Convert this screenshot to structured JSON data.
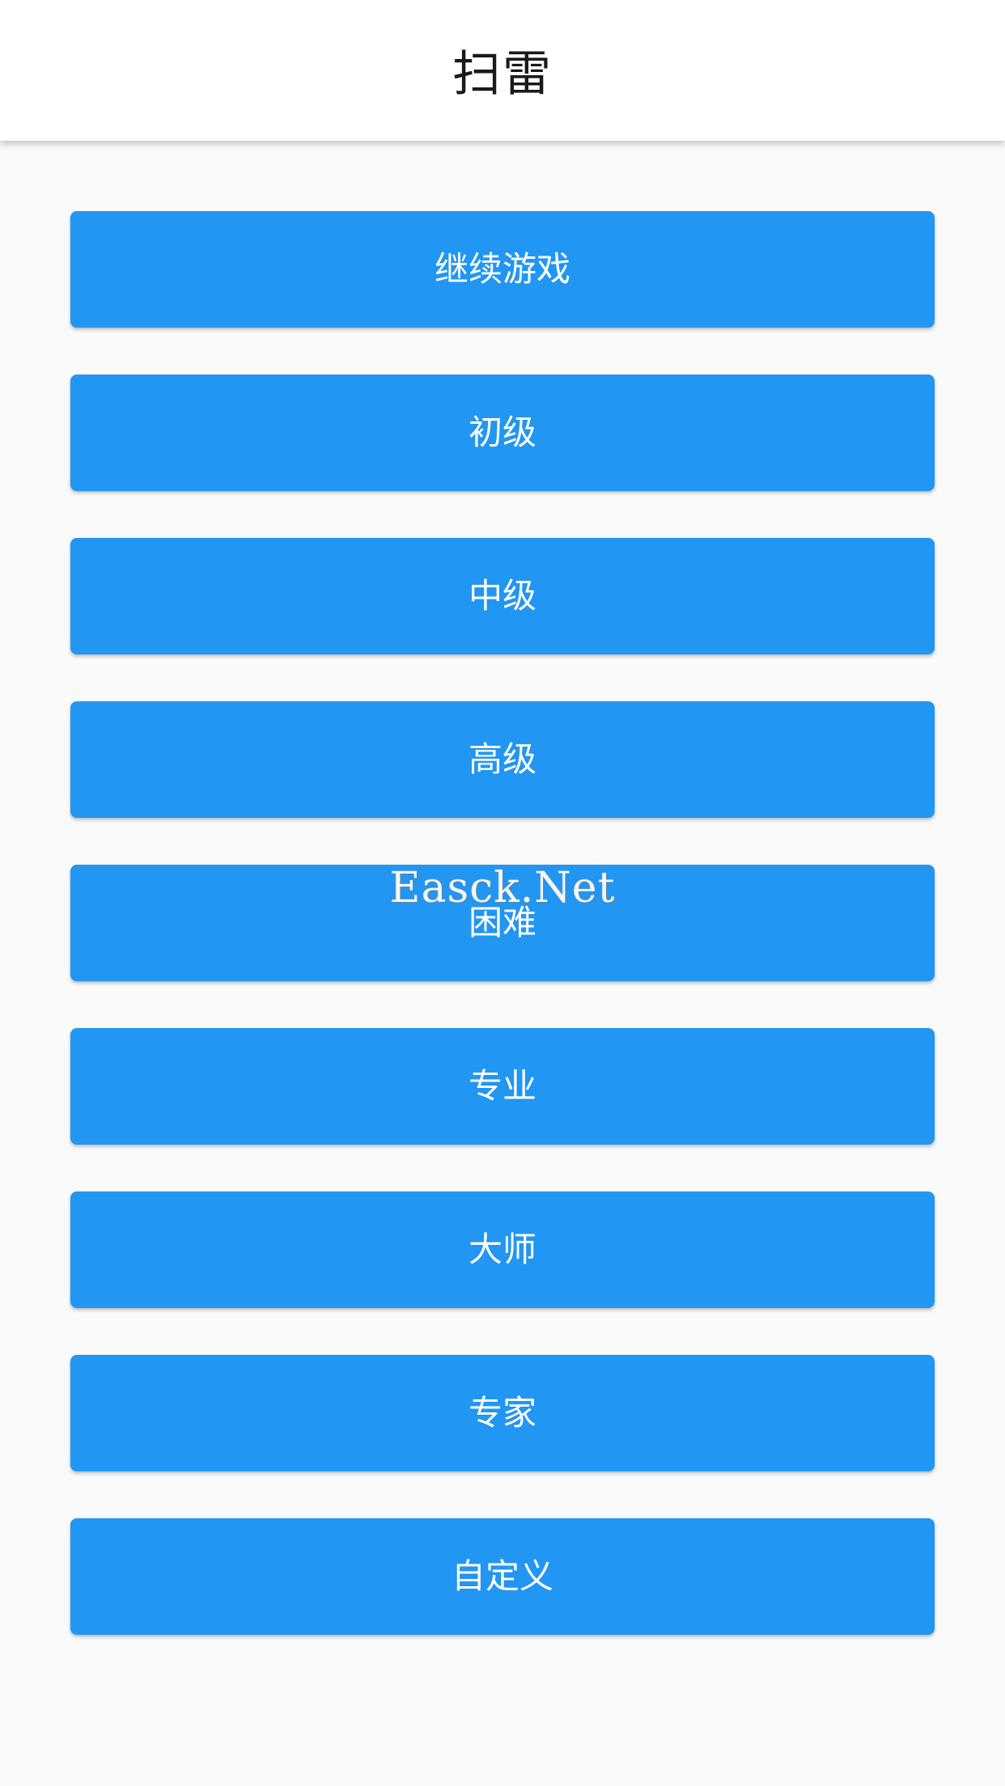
{
  "app_bar": {
    "title": "扫雷"
  },
  "menu": {
    "items": [
      {
        "id": "continue",
        "label": "继续游戏"
      },
      {
        "id": "beginner",
        "label": "初级"
      },
      {
        "id": "intermediate",
        "label": "中级"
      },
      {
        "id": "advanced",
        "label": "高级"
      },
      {
        "id": "hard",
        "label": "困难"
      },
      {
        "id": "professional",
        "label": "专业"
      },
      {
        "id": "master",
        "label": "大师"
      },
      {
        "id": "expert",
        "label": "专家"
      },
      {
        "id": "custom",
        "label": "自定义"
      }
    ]
  },
  "watermark": {
    "text": "Easck.Net"
  },
  "colors": {
    "button_bg": "#2196f3",
    "button_text": "#ffffff",
    "background": "#fafafa",
    "app_bar_bg": "#ffffff"
  }
}
